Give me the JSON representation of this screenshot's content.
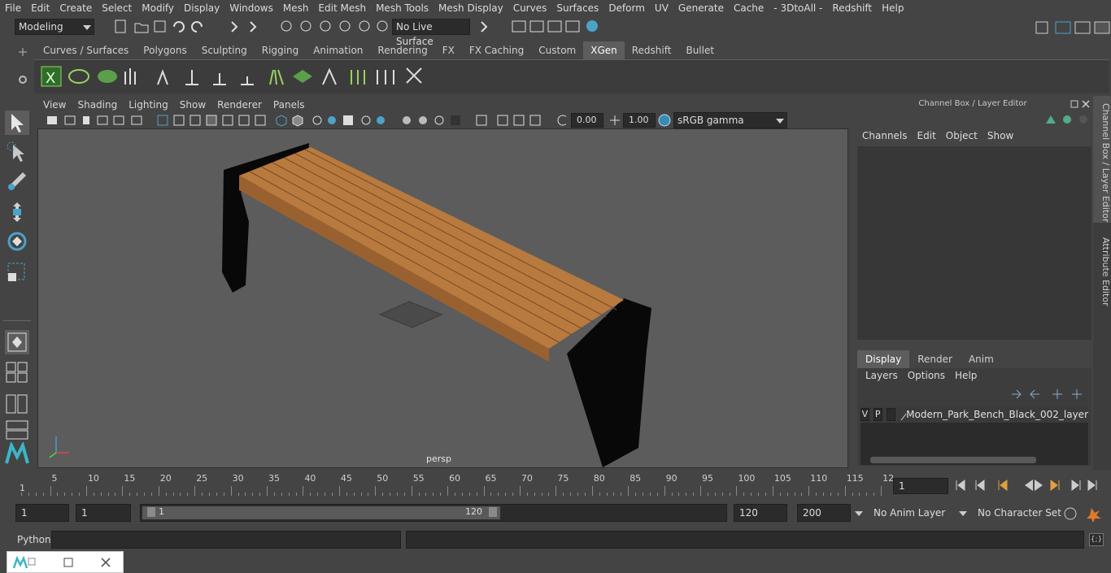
{
  "menubar": [
    "File",
    "Edit",
    "Create",
    "Select",
    "Modify",
    "Display",
    "Windows",
    "Mesh",
    "Edit Mesh",
    "Mesh Tools",
    "Mesh Display",
    "Curves",
    "Surfaces",
    "Deform",
    "UV",
    "Generate",
    "Cache",
    "- 3DtoAll -",
    "Redshift",
    "Help"
  ],
  "status": {
    "mode": "Modeling",
    "live_surface": "No Live Surface"
  },
  "shelf_tabs": [
    {
      "label": "Curves / Surfaces",
      "active": false
    },
    {
      "label": "Polygons",
      "active": false
    },
    {
      "label": "Sculpting",
      "active": false
    },
    {
      "label": "Rigging",
      "active": false
    },
    {
      "label": "Animation",
      "active": false
    },
    {
      "label": "Rendering",
      "active": false
    },
    {
      "label": "FX",
      "active": false
    },
    {
      "label": "FX Caching",
      "active": false
    },
    {
      "label": "Custom",
      "active": false
    },
    {
      "label": "XGen",
      "active": true
    },
    {
      "label": "Redshift",
      "active": false
    },
    {
      "label": "Bullet",
      "active": false
    }
  ],
  "viewport": {
    "menu": [
      "View",
      "Shading",
      "Lighting",
      "Show",
      "Renderer",
      "Panels"
    ],
    "exposure": "0.00",
    "gamma": "1.00",
    "color_space": "sRGB gamma",
    "camera_label": "persp"
  },
  "channel_box": {
    "title": "Channel Box / Layer Editor",
    "menu": [
      "Channels",
      "Edit",
      "Object",
      "Show"
    ]
  },
  "layer_editor": {
    "tabs": [
      {
        "label": "Display",
        "active": true
      },
      {
        "label": "Render",
        "active": false
      },
      {
        "label": "Anim",
        "active": false
      }
    ],
    "menu": [
      "Layers",
      "Options",
      "Help"
    ],
    "layer": {
      "v": "V",
      "p": "P",
      "name": "Modern_Park_Bench_Black_002_layer"
    }
  },
  "side_tabs": [
    "Channel Box / Layer Editor",
    "Attribute Editor"
  ],
  "timeline": {
    "ticks": [
      "5",
      "10",
      "15",
      "20",
      "25",
      "30",
      "35",
      "40",
      "45",
      "50",
      "55",
      "60",
      "65",
      "70",
      "75",
      "80",
      "85",
      "90",
      "95",
      "100",
      "105",
      "110",
      "115",
      "12"
    ],
    "current_frame": "1",
    "frame_field": "1"
  },
  "range": {
    "start": "1",
    "start2": "1",
    "slider_start": "1",
    "slider_end": "120",
    "end": "120",
    "max": "200",
    "anim_layer": "No Anim Layer",
    "char_set": "No Character Set"
  },
  "command": {
    "language": "Python"
  },
  "colors": {
    "wood": "#b87a3e",
    "bench_black": "#0a0a0a",
    "accent": "#4aa3c8"
  }
}
